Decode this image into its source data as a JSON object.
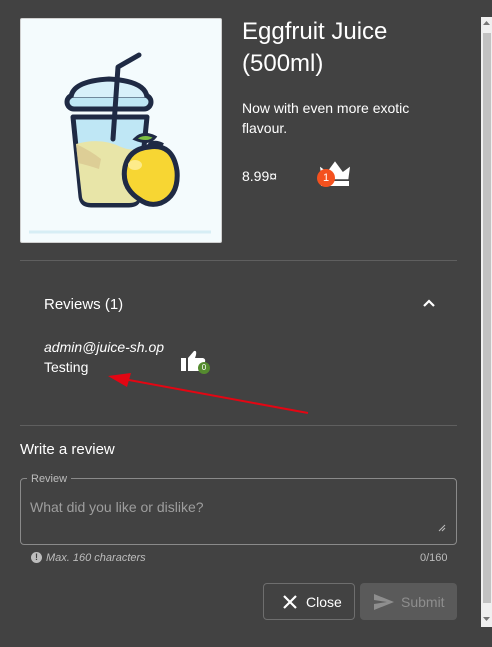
{
  "product": {
    "name_line1": "Eggfruit Juice",
    "name_line2": "(500ml)",
    "description": "Now with even more exotic flavour.",
    "price": "8.99¤",
    "deluxe_badge": "1",
    "image_icon": "juice-cup-with-eggfruit"
  },
  "reviews": {
    "header": "Reviews (1)",
    "items": [
      {
        "author": "admin@juice-sh.op",
        "text": "Testing",
        "likes": "0"
      }
    ]
  },
  "write_review": {
    "title": "Write a review",
    "field_label": "Review",
    "placeholder": "What did you like or dislike?",
    "hint": "Max. 160 characters",
    "counter": "0/160"
  },
  "actions": {
    "close_label": "Close",
    "submit_label": "Submit"
  },
  "colors": {
    "background": "#424242",
    "badge": "#f4511e",
    "like_badge": "#558b2f",
    "annotation_arrow": "#e30613"
  }
}
